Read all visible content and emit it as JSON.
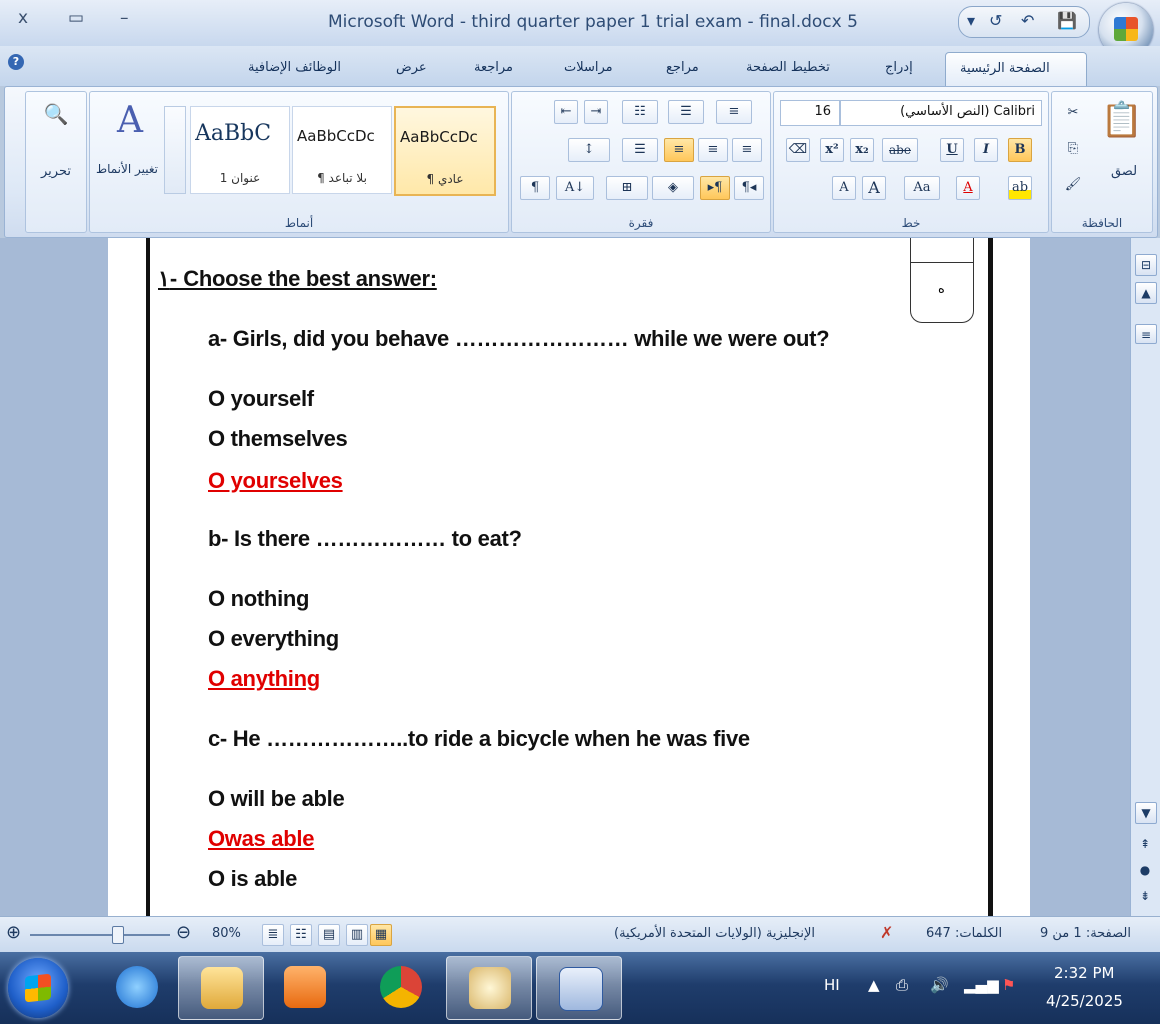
{
  "window": {
    "title": "Microsoft Word - third quarter paper 1 trial exam - final.docx 5",
    "controls": {
      "close": "x",
      "restore": "▭",
      "minimize": "–"
    }
  },
  "qat": {
    "redo": "↺",
    "undo": "↶",
    "save": "💾",
    "more": "▾"
  },
  "tabs": [
    "الصفحة الرئيسية",
    "إدراج",
    "تخطيط الصفحة",
    "مراجع",
    "مراسلات",
    "مراجعة",
    "عرض",
    "الوظائف الإضافية"
  ],
  "ribbon": {
    "clipboard": {
      "label": "الحافظة",
      "paste": "لصق"
    },
    "font": {
      "label": "خط",
      "font_name": "(النص الأساسي) Calibri",
      "font_size": "16"
    },
    "paragraph": {
      "label": "فقرة"
    },
    "styles": {
      "label": "أنماط",
      "items": [
        {
          "sample": "AaBbCcDc",
          "name": "¶ عادي"
        },
        {
          "sample": "AaBbCcDc",
          "name": "¶ بلا تباعد"
        },
        {
          "sample": "AaBbC",
          "name": "عنوان 1"
        }
      ],
      "change_styles": "تغيير الأنماط"
    },
    "editing": {
      "label": "تحرير"
    }
  },
  "document": {
    "grade_box_text": "ه",
    "heading": "١- Choose the best answer:",
    "questions": [
      {
        "q": "a- Girls, did you behave …………………… while we were out?",
        "options": [
          "O yourself",
          "O themselves",
          "O   yourselves"
        ],
        "answer_index": 2
      },
      {
        "q": "b- Is there ……………… to eat?",
        "options": [
          "O nothing",
          "O everything",
          "O anything"
        ],
        "answer_index": 2
      },
      {
        "q": "c- He ………………..to ride a bicycle when he was five",
        "options": [
          "O will be able",
          "Owas able",
          "O is able"
        ],
        "answer_index": 1
      }
    ]
  },
  "status": {
    "page": "الصفحة: 1 من 9",
    "words": "الكلمات: 647",
    "language": "الإنجليزية (الولايات المتحدة الأمريكية)",
    "zoom": "80%"
  },
  "taskbar": {
    "lang": "HI",
    "time": "2:32 PM",
    "date": "4/25/2025"
  }
}
